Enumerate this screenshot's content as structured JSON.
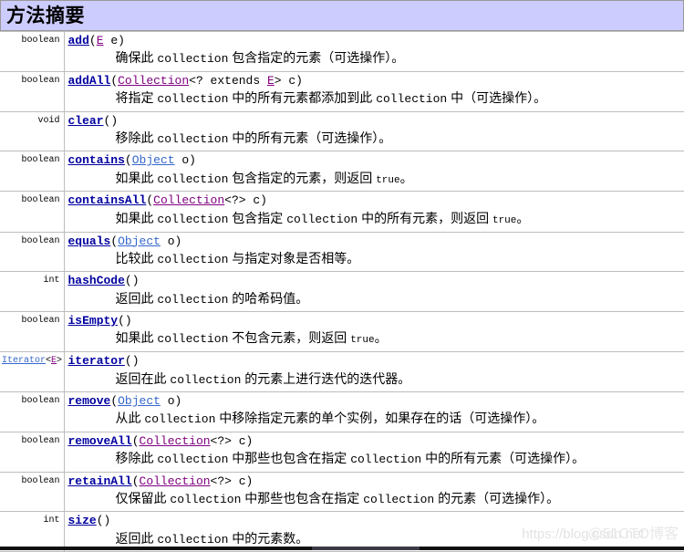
{
  "header": {
    "title": "方法摘要",
    "bg_color": "#ccccff",
    "border_color": "#9a9a9a"
  },
  "colors": {
    "method_link": "#0000a0",
    "visited_link": "#800080",
    "unvisited_link": "#3366cc",
    "row_border": "#bdbdbd"
  },
  "rows": [
    {
      "return_type": "boolean",
      "return_type_parts": [
        {
          "text": "boolean",
          "kind": "plain"
        }
      ],
      "method": "add",
      "sig_parts": [
        {
          "text": "(",
          "kind": "plain"
        },
        {
          "text": "E",
          "kind": "visited"
        },
        {
          "text": " e)",
          "kind": "plain"
        }
      ],
      "desc_parts": [
        {
          "text": "确保此 ",
          "kind": "cjk"
        },
        {
          "text": "collection",
          "kind": "mono"
        },
        {
          "text": " 包含指定的元素（可选操作）。",
          "kind": "cjk"
        }
      ]
    },
    {
      "return_type": "boolean",
      "return_type_parts": [
        {
          "text": "boolean",
          "kind": "plain"
        }
      ],
      "method": "addAll",
      "sig_parts": [
        {
          "text": "(",
          "kind": "plain"
        },
        {
          "text": "Collection",
          "kind": "visited"
        },
        {
          "text": "<? extends ",
          "kind": "plain"
        },
        {
          "text": "E",
          "kind": "visited"
        },
        {
          "text": "> c)",
          "kind": "plain"
        }
      ],
      "desc_parts": [
        {
          "text": "将指定 ",
          "kind": "cjk"
        },
        {
          "text": "collection",
          "kind": "mono"
        },
        {
          "text": " 中的所有元素都添加到此 ",
          "kind": "cjk"
        },
        {
          "text": "collection",
          "kind": "mono"
        },
        {
          "text": " 中（可选操作）。",
          "kind": "cjk"
        }
      ]
    },
    {
      "return_type": "void",
      "return_type_parts": [
        {
          "text": "void",
          "kind": "plain"
        }
      ],
      "method": "clear",
      "sig_parts": [
        {
          "text": "()",
          "kind": "plain"
        }
      ],
      "desc_parts": [
        {
          "text": "移除此 ",
          "kind": "cjk"
        },
        {
          "text": "collection",
          "kind": "mono"
        },
        {
          "text": " 中的所有元素（可选操作）。",
          "kind": "cjk"
        }
      ]
    },
    {
      "return_type": "boolean",
      "return_type_parts": [
        {
          "text": "boolean",
          "kind": "plain"
        }
      ],
      "method": "contains",
      "sig_parts": [
        {
          "text": "(",
          "kind": "plain"
        },
        {
          "text": "Object",
          "kind": "unvisited"
        },
        {
          "text": " o)",
          "kind": "plain"
        }
      ],
      "desc_parts": [
        {
          "text": "如果此 ",
          "kind": "cjk"
        },
        {
          "text": "collection",
          "kind": "mono"
        },
        {
          "text": " 包含指定的元素，则返回 ",
          "kind": "cjk"
        },
        {
          "text": "true",
          "kind": "code"
        },
        {
          "text": "。",
          "kind": "cjk"
        }
      ]
    },
    {
      "return_type": "boolean",
      "return_type_parts": [
        {
          "text": "boolean",
          "kind": "plain"
        }
      ],
      "method": "containsAll",
      "sig_parts": [
        {
          "text": "(",
          "kind": "plain"
        },
        {
          "text": "Collection",
          "kind": "visited"
        },
        {
          "text": "<?> c)",
          "kind": "plain"
        }
      ],
      "desc_parts": [
        {
          "text": "如果此 ",
          "kind": "cjk"
        },
        {
          "text": "collection",
          "kind": "mono"
        },
        {
          "text": " 包含指定 ",
          "kind": "cjk"
        },
        {
          "text": "collection",
          "kind": "mono"
        },
        {
          "text": " 中的所有元素，则返回 ",
          "kind": "cjk"
        },
        {
          "text": "true",
          "kind": "code"
        },
        {
          "text": "。",
          "kind": "cjk"
        }
      ]
    },
    {
      "return_type": "boolean",
      "return_type_parts": [
        {
          "text": "boolean",
          "kind": "plain"
        }
      ],
      "method": "equals",
      "sig_parts": [
        {
          "text": "(",
          "kind": "plain"
        },
        {
          "text": "Object",
          "kind": "unvisited"
        },
        {
          "text": " o)",
          "kind": "plain"
        }
      ],
      "desc_parts": [
        {
          "text": "比较此 ",
          "kind": "cjk"
        },
        {
          "text": "collection",
          "kind": "mono"
        },
        {
          "text": " 与指定对象是否相等。",
          "kind": "cjk"
        }
      ]
    },
    {
      "return_type": "int",
      "return_type_parts": [
        {
          "text": "int",
          "kind": "plain"
        }
      ],
      "method": "hashCode",
      "sig_parts": [
        {
          "text": "()",
          "kind": "plain"
        }
      ],
      "desc_parts": [
        {
          "text": "返回此 ",
          "kind": "cjk"
        },
        {
          "text": "collection",
          "kind": "mono"
        },
        {
          "text": " 的哈希码值。",
          "kind": "cjk"
        }
      ]
    },
    {
      "return_type": "boolean",
      "return_type_parts": [
        {
          "text": "boolean",
          "kind": "plain"
        }
      ],
      "method": "isEmpty",
      "sig_parts": [
        {
          "text": "()",
          "kind": "plain"
        }
      ],
      "desc_parts": [
        {
          "text": "如果此 ",
          "kind": "cjk"
        },
        {
          "text": "collection",
          "kind": "mono"
        },
        {
          "text": " 不包含元素，则返回 ",
          "kind": "cjk"
        },
        {
          "text": "true",
          "kind": "code"
        },
        {
          "text": "。",
          "kind": "cjk"
        }
      ]
    },
    {
      "return_type": "Iterator<E>",
      "return_type_parts": [
        {
          "text": "Iterator",
          "kind": "unvisited"
        },
        {
          "text": "<",
          "kind": "plain"
        },
        {
          "text": "E",
          "kind": "visited"
        },
        {
          "text": ">",
          "kind": "plain"
        }
      ],
      "method": "iterator",
      "sig_parts": [
        {
          "text": "()",
          "kind": "plain"
        }
      ],
      "desc_parts": [
        {
          "text": "返回在此 ",
          "kind": "cjk"
        },
        {
          "text": "collection",
          "kind": "mono"
        },
        {
          "text": " 的元素上进行迭代的迭代器。",
          "kind": "cjk"
        }
      ]
    },
    {
      "return_type": "boolean",
      "return_type_parts": [
        {
          "text": "boolean",
          "kind": "plain"
        }
      ],
      "method": "remove",
      "sig_parts": [
        {
          "text": "(",
          "kind": "plain"
        },
        {
          "text": "Object",
          "kind": "unvisited"
        },
        {
          "text": " o)",
          "kind": "plain"
        }
      ],
      "desc_parts": [
        {
          "text": "从此 ",
          "kind": "cjk"
        },
        {
          "text": "collection",
          "kind": "mono"
        },
        {
          "text": " 中移除指定元素的单个实例，如果存在的话（可选操作）。",
          "kind": "cjk"
        }
      ]
    },
    {
      "return_type": "boolean",
      "return_type_parts": [
        {
          "text": "boolean",
          "kind": "plain"
        }
      ],
      "method": "removeAll",
      "sig_parts": [
        {
          "text": "(",
          "kind": "plain"
        },
        {
          "text": "Collection",
          "kind": "visited"
        },
        {
          "text": "<?> c)",
          "kind": "plain"
        }
      ],
      "desc_parts": [
        {
          "text": "移除此 ",
          "kind": "cjk"
        },
        {
          "text": "collection",
          "kind": "mono"
        },
        {
          "text": " 中那些也包含在指定 ",
          "kind": "cjk"
        },
        {
          "text": "collection",
          "kind": "mono"
        },
        {
          "text": " 中的所有元素（可选操作）。",
          "kind": "cjk"
        }
      ]
    },
    {
      "return_type": "boolean",
      "return_type_parts": [
        {
          "text": "boolean",
          "kind": "plain"
        }
      ],
      "method": "retainAll",
      "sig_parts": [
        {
          "text": "(",
          "kind": "plain"
        },
        {
          "text": "Collection",
          "kind": "visited"
        },
        {
          "text": "<?> c)",
          "kind": "plain"
        }
      ],
      "desc_parts": [
        {
          "text": "仅保留此 ",
          "kind": "cjk"
        },
        {
          "text": "collection",
          "kind": "mono"
        },
        {
          "text": " 中那些也包含在指定 ",
          "kind": "cjk"
        },
        {
          "text": "collection",
          "kind": "mono"
        },
        {
          "text": " 的元素（可选操作）。",
          "kind": "cjk"
        }
      ]
    },
    {
      "return_type": "int",
      "return_type_parts": [
        {
          "text": "int",
          "kind": "plain"
        }
      ],
      "method": "size",
      "sig_parts": [
        {
          "text": "()",
          "kind": "plain"
        }
      ],
      "desc_parts": [
        {
          "text": "返回此 ",
          "kind": "cjk"
        },
        {
          "text": "collection",
          "kind": "mono"
        },
        {
          "text": " 中的元素数。",
          "kind": "cjk"
        }
      ]
    }
  ],
  "watermark": {
    "url_text": "https://blog.csdn.net",
    "blog_text": "@51CTO博客"
  }
}
